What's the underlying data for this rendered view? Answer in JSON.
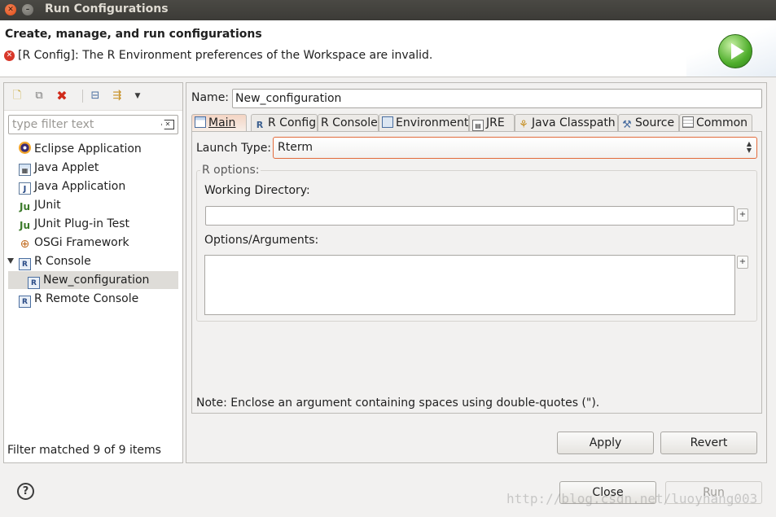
{
  "window": {
    "title": "Run Configurations"
  },
  "header": {
    "title": "Create, manage, and run configurations",
    "message": "[R Config]: The R Environment preferences of the Workspace are invalid.",
    "error_icon": "✕",
    "banner_icon": "run-icon"
  },
  "left": {
    "filter_placeholder": "type filter text",
    "toolbar_icons": [
      "new-config-icon",
      "duplicate-icon",
      "delete-icon",
      "collapse-all-icon",
      "filter-icon",
      "view-menu-icon"
    ],
    "tree": [
      {
        "label": "Eclipse Application",
        "icon": "eclipse-icon"
      },
      {
        "label": "Java Applet",
        "icon": "java-applet-icon"
      },
      {
        "label": "Java Application",
        "icon": "java-application-icon"
      },
      {
        "label": "JUnit",
        "icon": "junit-icon"
      },
      {
        "label": "JUnit Plug-in Test",
        "icon": "junit-plugin-icon"
      },
      {
        "label": "OSGi Framework",
        "icon": "osgi-icon"
      },
      {
        "label": "R Console",
        "icon": "r-console-icon",
        "expanded": true
      },
      {
        "label": "New_configuration",
        "icon": "r-console-icon",
        "selected": true
      },
      {
        "label": "R Remote Console",
        "icon": "r-remote-console-icon"
      }
    ],
    "status": "Filter matched 9 of 9 items"
  },
  "right": {
    "name_label": "Name:",
    "name_value": "New_configuration",
    "tabs": [
      {
        "label": "Main",
        "active": true
      },
      {
        "label": "R Config"
      },
      {
        "label": "R Console"
      },
      {
        "label": "Environment"
      },
      {
        "label": "JRE"
      },
      {
        "label": "Java Classpath"
      },
      {
        "label": "Source"
      },
      {
        "label": "Common"
      }
    ],
    "launch_type_label": "Launch Type:",
    "launch_type_value": "Rterm",
    "group_label": "R options:",
    "working_dir_label": "Working Directory:",
    "working_dir_value": "",
    "options_label": "Options/Arguments:",
    "options_value": "",
    "note": "Note: Enclose an argument containing spaces using double-quotes (\").",
    "apply_label": "Apply",
    "revert_label": "Revert"
  },
  "footer": {
    "help_label": "?",
    "close_label": "Close",
    "run_label": "Run"
  },
  "watermark": "http://blog.csdn.net/luoyhang003",
  "colors": {
    "accent_border": "#e26b3c",
    "run_green": "#4fae2c",
    "error_red": "#d8382a"
  }
}
